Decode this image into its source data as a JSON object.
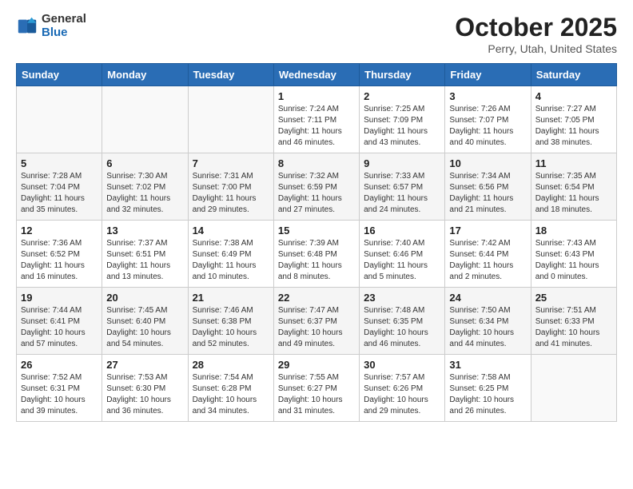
{
  "header": {
    "logo_general": "General",
    "logo_blue": "Blue",
    "title": "October 2025",
    "subtitle": "Perry, Utah, United States"
  },
  "weekdays": [
    "Sunday",
    "Monday",
    "Tuesday",
    "Wednesday",
    "Thursday",
    "Friday",
    "Saturday"
  ],
  "weeks": [
    [
      {
        "day": "",
        "info": ""
      },
      {
        "day": "",
        "info": ""
      },
      {
        "day": "",
        "info": ""
      },
      {
        "day": "1",
        "info": "Sunrise: 7:24 AM\nSunset: 7:11 PM\nDaylight: 11 hours\nand 46 minutes."
      },
      {
        "day": "2",
        "info": "Sunrise: 7:25 AM\nSunset: 7:09 PM\nDaylight: 11 hours\nand 43 minutes."
      },
      {
        "day": "3",
        "info": "Sunrise: 7:26 AM\nSunset: 7:07 PM\nDaylight: 11 hours\nand 40 minutes."
      },
      {
        "day": "4",
        "info": "Sunrise: 7:27 AM\nSunset: 7:05 PM\nDaylight: 11 hours\nand 38 minutes."
      }
    ],
    [
      {
        "day": "5",
        "info": "Sunrise: 7:28 AM\nSunset: 7:04 PM\nDaylight: 11 hours\nand 35 minutes."
      },
      {
        "day": "6",
        "info": "Sunrise: 7:30 AM\nSunset: 7:02 PM\nDaylight: 11 hours\nand 32 minutes."
      },
      {
        "day": "7",
        "info": "Sunrise: 7:31 AM\nSunset: 7:00 PM\nDaylight: 11 hours\nand 29 minutes."
      },
      {
        "day": "8",
        "info": "Sunrise: 7:32 AM\nSunset: 6:59 PM\nDaylight: 11 hours\nand 27 minutes."
      },
      {
        "day": "9",
        "info": "Sunrise: 7:33 AM\nSunset: 6:57 PM\nDaylight: 11 hours\nand 24 minutes."
      },
      {
        "day": "10",
        "info": "Sunrise: 7:34 AM\nSunset: 6:56 PM\nDaylight: 11 hours\nand 21 minutes."
      },
      {
        "day": "11",
        "info": "Sunrise: 7:35 AM\nSunset: 6:54 PM\nDaylight: 11 hours\nand 18 minutes."
      }
    ],
    [
      {
        "day": "12",
        "info": "Sunrise: 7:36 AM\nSunset: 6:52 PM\nDaylight: 11 hours\nand 16 minutes."
      },
      {
        "day": "13",
        "info": "Sunrise: 7:37 AM\nSunset: 6:51 PM\nDaylight: 11 hours\nand 13 minutes."
      },
      {
        "day": "14",
        "info": "Sunrise: 7:38 AM\nSunset: 6:49 PM\nDaylight: 11 hours\nand 10 minutes."
      },
      {
        "day": "15",
        "info": "Sunrise: 7:39 AM\nSunset: 6:48 PM\nDaylight: 11 hours\nand 8 minutes."
      },
      {
        "day": "16",
        "info": "Sunrise: 7:40 AM\nSunset: 6:46 PM\nDaylight: 11 hours\nand 5 minutes."
      },
      {
        "day": "17",
        "info": "Sunrise: 7:42 AM\nSunset: 6:44 PM\nDaylight: 11 hours\nand 2 minutes."
      },
      {
        "day": "18",
        "info": "Sunrise: 7:43 AM\nSunset: 6:43 PM\nDaylight: 11 hours\nand 0 minutes."
      }
    ],
    [
      {
        "day": "19",
        "info": "Sunrise: 7:44 AM\nSunset: 6:41 PM\nDaylight: 10 hours\nand 57 minutes."
      },
      {
        "day": "20",
        "info": "Sunrise: 7:45 AM\nSunset: 6:40 PM\nDaylight: 10 hours\nand 54 minutes."
      },
      {
        "day": "21",
        "info": "Sunrise: 7:46 AM\nSunset: 6:38 PM\nDaylight: 10 hours\nand 52 minutes."
      },
      {
        "day": "22",
        "info": "Sunrise: 7:47 AM\nSunset: 6:37 PM\nDaylight: 10 hours\nand 49 minutes."
      },
      {
        "day": "23",
        "info": "Sunrise: 7:48 AM\nSunset: 6:35 PM\nDaylight: 10 hours\nand 46 minutes."
      },
      {
        "day": "24",
        "info": "Sunrise: 7:50 AM\nSunset: 6:34 PM\nDaylight: 10 hours\nand 44 minutes."
      },
      {
        "day": "25",
        "info": "Sunrise: 7:51 AM\nSunset: 6:33 PM\nDaylight: 10 hours\nand 41 minutes."
      }
    ],
    [
      {
        "day": "26",
        "info": "Sunrise: 7:52 AM\nSunset: 6:31 PM\nDaylight: 10 hours\nand 39 minutes."
      },
      {
        "day": "27",
        "info": "Sunrise: 7:53 AM\nSunset: 6:30 PM\nDaylight: 10 hours\nand 36 minutes."
      },
      {
        "day": "28",
        "info": "Sunrise: 7:54 AM\nSunset: 6:28 PM\nDaylight: 10 hours\nand 34 minutes."
      },
      {
        "day": "29",
        "info": "Sunrise: 7:55 AM\nSunset: 6:27 PM\nDaylight: 10 hours\nand 31 minutes."
      },
      {
        "day": "30",
        "info": "Sunrise: 7:57 AM\nSunset: 6:26 PM\nDaylight: 10 hours\nand 29 minutes."
      },
      {
        "day": "31",
        "info": "Sunrise: 7:58 AM\nSunset: 6:25 PM\nDaylight: 10 hours\nand 26 minutes."
      },
      {
        "day": "",
        "info": ""
      }
    ]
  ]
}
